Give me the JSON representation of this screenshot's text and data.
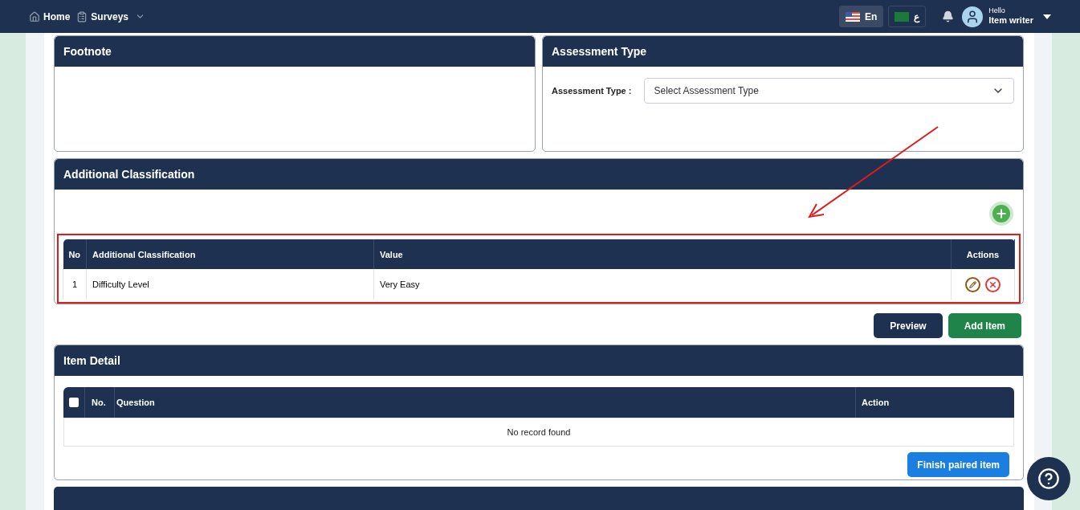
{
  "nav": {
    "items": [
      {
        "label": "Home",
        "kind": "home"
      },
      {
        "label": "Surveys",
        "kind": "dropdown"
      }
    ],
    "languages": [
      {
        "label": "En",
        "selected": true,
        "kind": "us"
      },
      {
        "label": "ع",
        "selected": false,
        "kind": "sa"
      }
    ],
    "user": {
      "greeting": "Hello",
      "name": "Item writer"
    }
  },
  "footnote": {
    "title": "Footnote"
  },
  "assessment": {
    "title": "Assessment Type",
    "label": "Assessment Type :",
    "placeholder": "Select Assessment Type"
  },
  "classification": {
    "title": "Additional Classification",
    "columns": [
      "No",
      "Additional Classification",
      "Value",
      "Actions"
    ],
    "rows": [
      {
        "no": "1",
        "name": "Difficulty Level",
        "value": "Very Easy"
      }
    ]
  },
  "buttons": [
    {
      "label": "Preview",
      "kind": "dark"
    },
    {
      "label": "Add Item",
      "kind": "green"
    }
  ],
  "item_detail": {
    "title": "Item Detail",
    "select_all_checked": false,
    "columns": [
      "No.",
      "Question",
      "Action"
    ],
    "empty": "No record found",
    "finish": "Finish paired item"
  }
}
